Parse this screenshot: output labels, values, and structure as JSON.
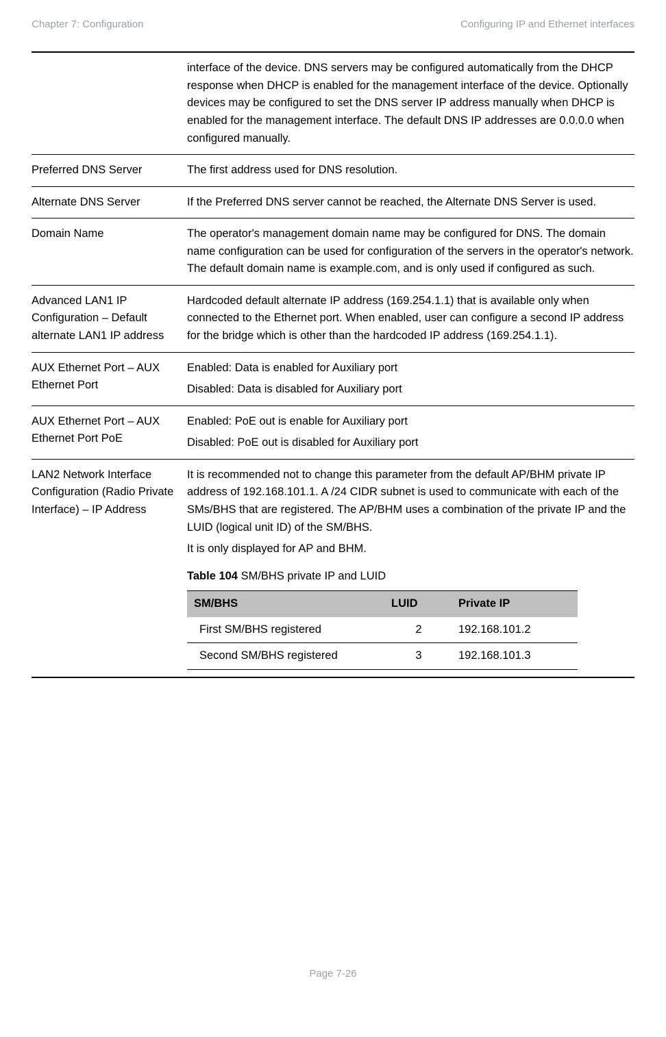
{
  "header": {
    "left": "Chapter 7:  Configuration",
    "right": "Configuring IP and Ethernet interfaces"
  },
  "rows": {
    "r0": {
      "attr": "",
      "desc": "interface of the device. DNS servers may be configured automatically from the DHCP response when DHCP is enabled for the management interface of the device. Optionally devices may be configured to set the DNS server IP address manually when DHCP is enabled for the management interface. The default DNS IP addresses are 0.0.0.0 when configured manually."
    },
    "r1": {
      "attr": "Preferred DNS Server",
      "desc": "The first address used for DNS resolution."
    },
    "r2": {
      "attr": "Alternate DNS Server",
      "desc": "If the Preferred DNS server cannot be reached, the Alternate DNS Server is used."
    },
    "r3": {
      "attr": "Domain Name",
      "desc": "The operator's management domain name may be configured for DNS. The domain name configuration can be used for configuration of the servers in the operator's network. The default domain name is example.com, and is only used if configured as such."
    },
    "r4": {
      "attr": "Advanced LAN1 IP Configuration – Default alternate LAN1 IP address",
      "desc": "Hardcoded default alternate IP address (169.254.1.1) that is available only when connected to the Ethernet port. When enabled, user can configure a second IP address for the bridge which is other than the hardcoded IP address (169.254.1.1)."
    },
    "r5": {
      "attr": "AUX Ethernet Port – AUX Ethernet Port",
      "desc1": "Enabled: Data is enabled for Auxiliary port",
      "desc2": "Disabled: Data is disabled for Auxiliary port"
    },
    "r6": {
      "attr": "AUX Ethernet Port – AUX Ethernet Port PoE",
      "desc1": "Enabled: PoE out is enable for Auxiliary port",
      "desc2": "Disabled: PoE out is disabled for Auxiliary port"
    },
    "r7": {
      "attr": "LAN2 Network Interface Configuration (Radio Private Interface) – IP Address",
      "desc1": "It is recommended not to change this parameter from the default AP/BHM private IP address of 192.168.101.1. A /24 CIDR subnet is used to communicate with each of the SMs/BHS that are registered. The AP/BHM uses a combination of the private IP and the LUID (logical unit ID) of the SM/BHS.",
      "desc2": "It is only displayed for AP and BHM.",
      "table_caption_bold": "Table 104",
      "table_caption_rest": " SM/BHS private IP and LUID",
      "table": {
        "h1": "SM/BHS",
        "h2": "LUID",
        "h3": "Private IP",
        "row1": {
          "c1": "First SM/BHS registered",
          "c2": "2",
          "c3": "192.168.101.2"
        },
        "row2": {
          "c1": "Second SM/BHS registered",
          "c2": "3",
          "c3": "192.168.101.3"
        }
      }
    }
  },
  "footer": "Page 7-26"
}
